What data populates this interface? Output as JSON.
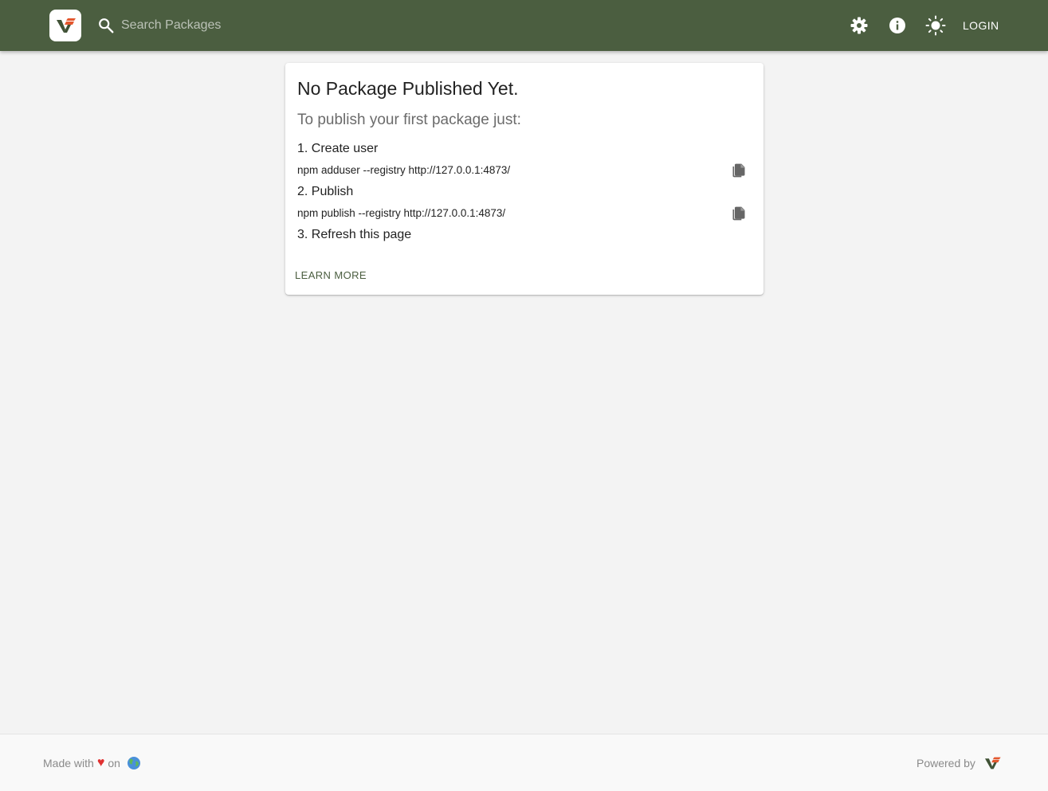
{
  "header": {
    "search_placeholder": "Search Packages",
    "login_label": "LOGIN",
    "icons": [
      "settings-icon",
      "info-icon",
      "sun-icon"
    ],
    "bar_color": "#4b5e40"
  },
  "card": {
    "title": "No Package Published Yet.",
    "subtitle": "To publish your first package just:",
    "steps": [
      {
        "label": "1. Create user",
        "command": "npm adduser --registry http://127.0.0.1:4873/"
      },
      {
        "label": "2. Publish",
        "command": "npm publish --registry http://127.0.0.1:4873/"
      },
      {
        "label": "3. Refresh this page"
      }
    ],
    "learn_more": "LEARN MORE"
  },
  "footer": {
    "made_with": "Made with",
    "heart": "♥",
    "on": "on",
    "powered_by": "Powered by"
  }
}
